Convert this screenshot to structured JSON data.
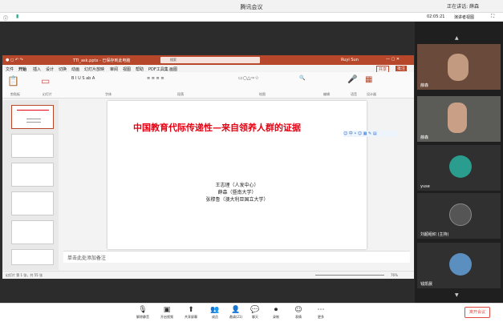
{
  "window": {
    "title": "腾讯会议",
    "speaking": "正在讲话: 薛森"
  },
  "topbar": {
    "time": "02:05:21",
    "view": "演讲者视图"
  },
  "ppt": {
    "title": "TTI_ask.pptx - 已保存到此电脑",
    "search_placeholder": "搜索",
    "user": "Ruyi Sun",
    "tabs": [
      "文件",
      "开始",
      "插入",
      "设计",
      "切换",
      "动画",
      "幻灯片放映",
      "审阅",
      "视图",
      "帮助",
      "PDF工具集",
      "画图"
    ],
    "share": "共享",
    "comment": "批注",
    "groups": [
      "剪贴板",
      "幻灯片",
      "字体",
      "段落",
      "绘图",
      "编辑",
      "语音",
      "设计器"
    ]
  },
  "slide": {
    "title": "中国教育代际传递性—来自领养人群的证据",
    "authors": [
      "王志理（人发中心）",
      "薛森（暨南大学）",
      "张穆鲁（澳大利亚国立大学）"
    ]
  },
  "notes_placeholder": "单击此处添加备注",
  "status": {
    "left": "幻灯片 第 1 张，共 55 张",
    "zoom": "76%"
  },
  "videos": [
    {
      "name": "薛森"
    },
    {
      "name": "薛森"
    },
    {
      "name": "yuse"
    },
    {
      "name": "刘超组织 (主持)"
    },
    {
      "name": "钱凯晨"
    }
  ],
  "bottombar": {
    "buttons": [
      "解除静音",
      "开启视频",
      "共享屏幕",
      "成员",
      "邀请(21)",
      "聊天",
      "录制",
      "表情",
      "更多"
    ],
    "end": "离开会议"
  },
  "colors": {
    "accent": "#b7472a",
    "title_red": "#e60012"
  }
}
